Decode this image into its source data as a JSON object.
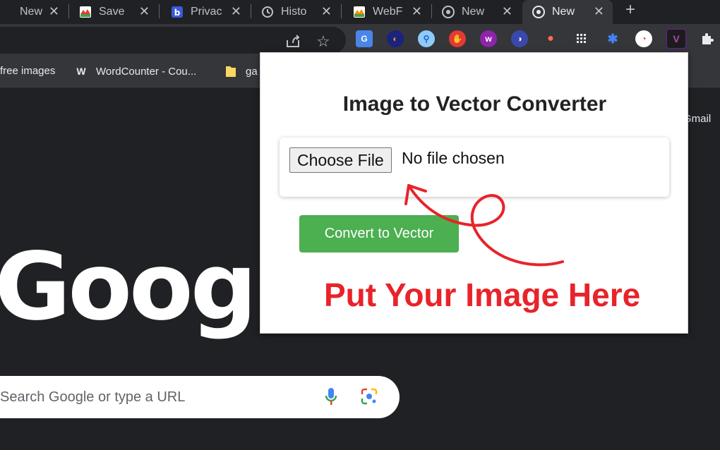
{
  "tabs": [
    {
      "title": "New",
      "icon": "new-tab-icon"
    },
    {
      "title": "Save",
      "icon": "colorful-favicon-icon"
    },
    {
      "title": "Privac",
      "icon": "privacy-favicon-icon"
    },
    {
      "title": "Histo",
      "icon": "history-icon"
    },
    {
      "title": "WebF",
      "icon": "colorful-favicon-icon"
    },
    {
      "title": "New",
      "icon": "chrome-icon"
    },
    {
      "title": "New",
      "icon": "chrome-icon"
    }
  ],
  "bookmarks": [
    {
      "label": "free images"
    },
    {
      "label": "WordCounter - Cou...",
      "icon_text": "W"
    },
    {
      "label": "ga"
    }
  ],
  "ntp": {
    "logo": "Google",
    "gmail": "Gmail",
    "search_placeholder": "Search Google or type a URL"
  },
  "popup": {
    "title": "Image to Vector Converter",
    "choose_file": "Choose File",
    "no_file": "No file chosen",
    "convert": "Convert to Vector",
    "annotation": "Put Your Image Here"
  },
  "colors": {
    "accent_green": "#4caf50",
    "annotation_red": "#e8232a",
    "chrome_dark": "#202124",
    "toolbar": "#35363a"
  }
}
